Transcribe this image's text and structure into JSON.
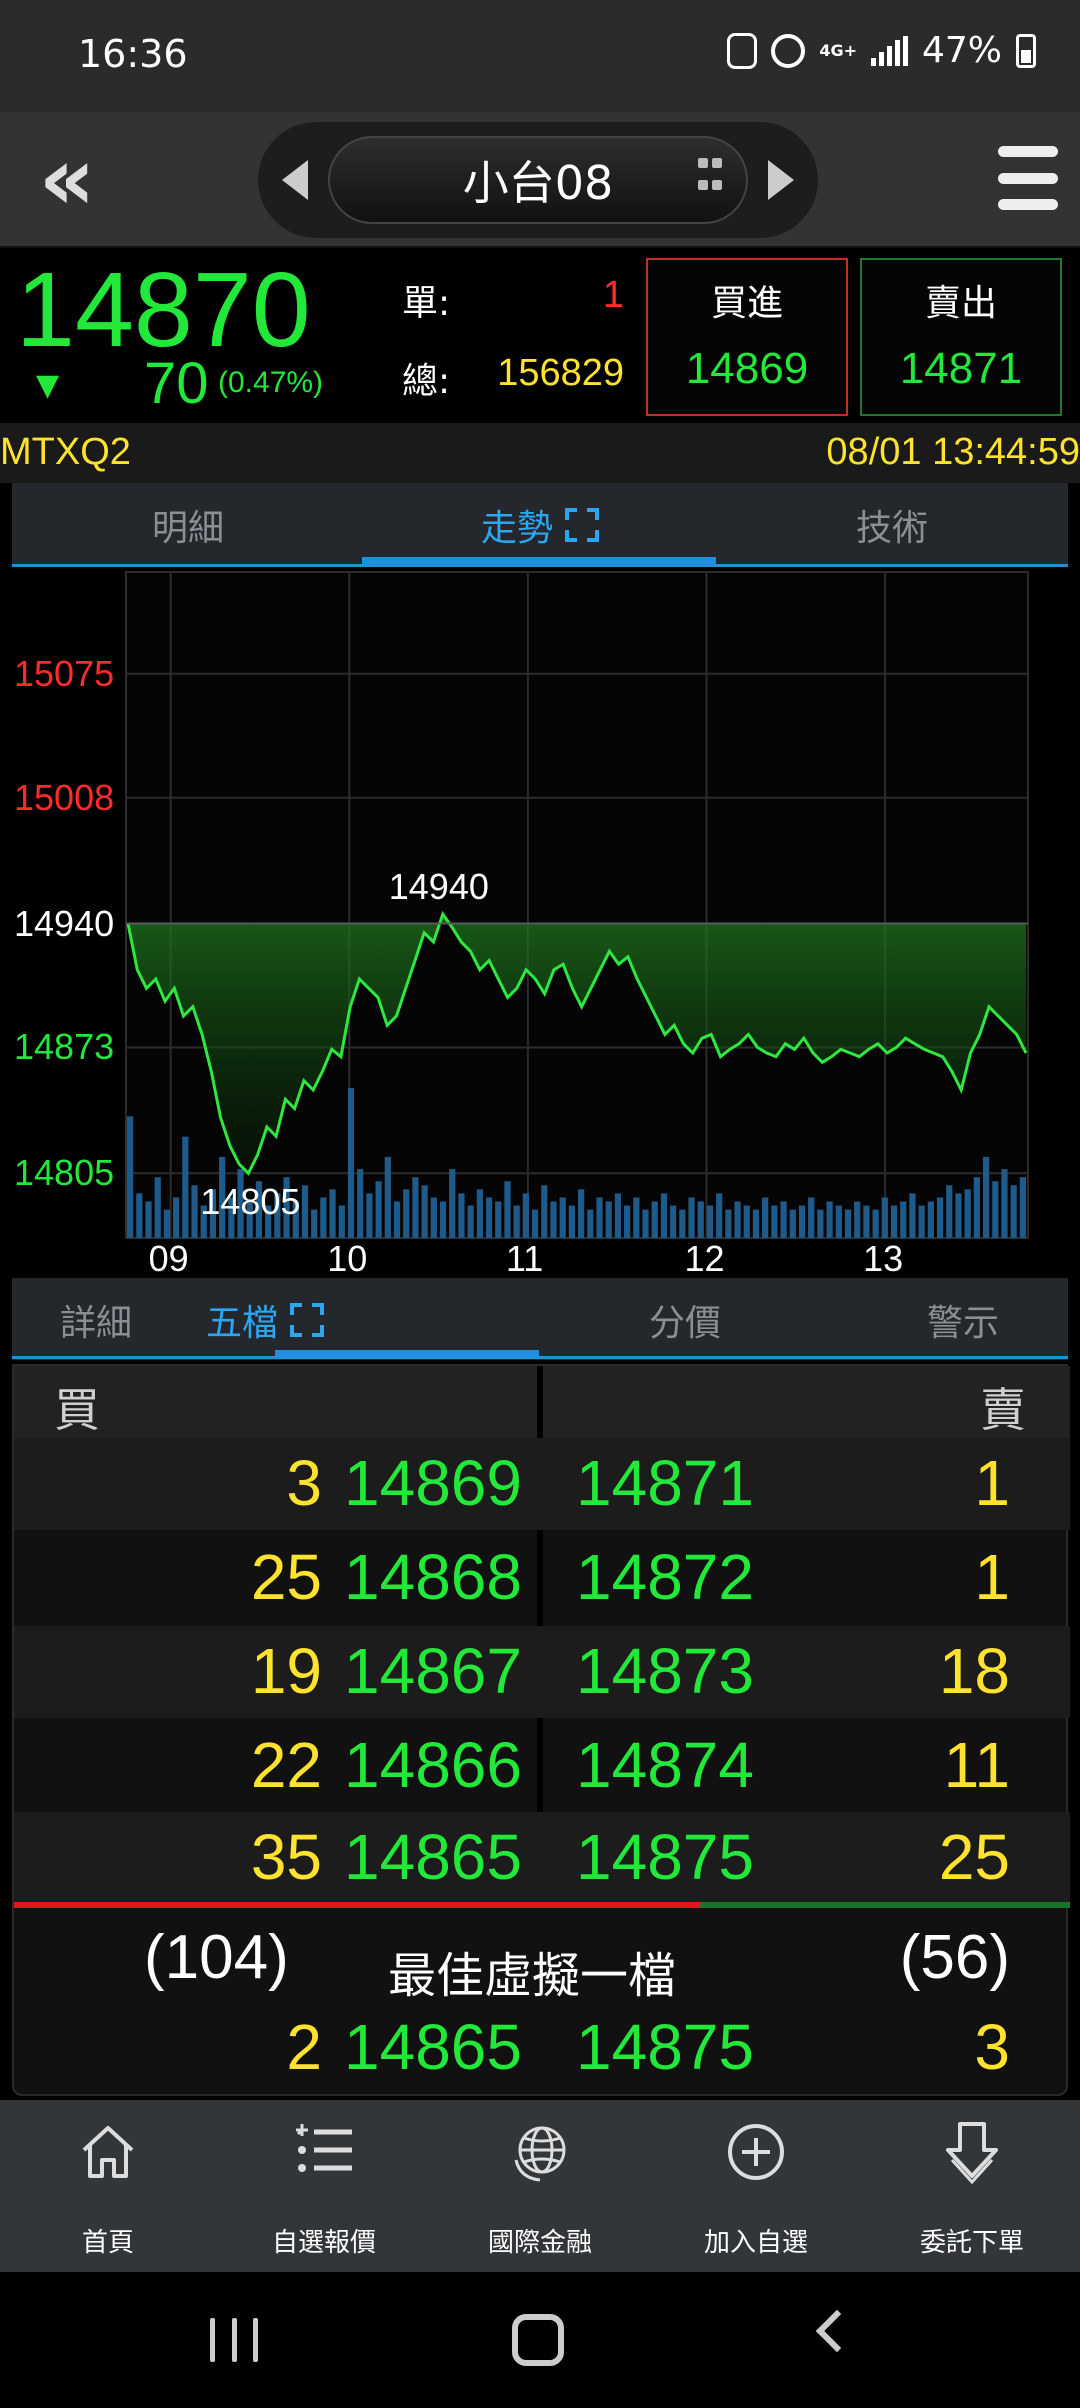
{
  "status_bar": {
    "time": "16:36",
    "network": "4G+",
    "battery": "47%"
  },
  "header": {
    "symbol": "小台08"
  },
  "quote": {
    "last": "14870",
    "change_arrow": "▼",
    "change": "70",
    "change_pct": "(0.47%)",
    "single_label": "單:",
    "single_value": "1",
    "total_label": "總:",
    "total_value": "156829",
    "bid_label": "買進",
    "bid_value": "14869",
    "ask_label": "賣出",
    "ask_value": "14871",
    "code": "MTXQ2",
    "datetime": "08/01 13:44:59"
  },
  "tabs_top": [
    {
      "label": "明細",
      "active": false
    },
    {
      "label": "走勢",
      "active": true
    },
    {
      "label": "技術",
      "active": false
    }
  ],
  "chart_data": {
    "type": "line",
    "y_ticks": [
      {
        "value": 15075,
        "label": "15075",
        "color": "#ff2a2a"
      },
      {
        "value": 15008,
        "label": "15008",
        "color": "#ff2a2a"
      },
      {
        "value": 14940,
        "label": "14940",
        "color": "#ffffff"
      },
      {
        "value": 14873,
        "label": "14873",
        "color": "#22e83a"
      },
      {
        "value": 14805,
        "label": "14805",
        "color": "#22e83a"
      }
    ],
    "x_ticks": [
      "09",
      "10",
      "11",
      "12",
      "13"
    ],
    "ylim": [
      14770,
      15130
    ],
    "reference": 14940,
    "high": {
      "value": 14940,
      "label": "14940"
    },
    "low": {
      "value": 14805,
      "label": "14805"
    },
    "series": [
      {
        "values": [
          14940,
          14915,
          14905,
          14910,
          14898,
          14905,
          14890,
          14895,
          14880,
          14860,
          14835,
          14820,
          14810,
          14805,
          14815,
          14830,
          14825,
          14845,
          14840,
          14855,
          14850,
          14860,
          14872,
          14868,
          14895,
          14910,
          14905,
          14900,
          14885,
          14890,
          14905,
          14920,
          14935,
          14930,
          14945,
          14938,
          14930,
          14925,
          14915,
          14920,
          14910,
          14900,
          14905,
          14915,
          14910,
          14902,
          14915,
          14918,
          14905,
          14895,
          14905,
          14915,
          14925,
          14918,
          14922,
          14910,
          14900,
          14890,
          14880,
          14885,
          14875,
          14870,
          14878,
          14880,
          14868,
          14872,
          14875,
          14880,
          14873,
          14870,
          14868,
          14875,
          14872,
          14878,
          14870,
          14865,
          14868,
          14872,
          14870,
          14868,
          14872,
          14875,
          14870,
          14873,
          14878,
          14875,
          14872,
          14870,
          14868,
          14860,
          14850,
          14870,
          14880,
          14895,
          14890,
          14885,
          14880,
          14870
        ]
      }
    ],
    "volume": [
      60,
      22,
      18,
      30,
      14,
      20,
      50,
      26,
      16,
      24,
      40,
      20,
      34,
      18,
      28,
      16,
      22,
      30,
      18,
      26,
      14,
      20,
      24,
      16,
      74,
      34,
      22,
      28,
      40,
      18,
      24,
      30,
      26,
      20,
      18,
      34,
      22,
      16,
      24,
      20,
      18,
      28,
      16,
      22,
      14,
      26,
      18,
      20,
      16,
      24,
      14,
      20,
      18,
      22,
      16,
      20,
      14,
      18,
      22,
      16,
      14,
      20,
      18,
      16,
      22,
      14,
      18,
      16,
      14,
      20,
      16,
      18,
      14,
      16,
      20,
      14,
      18,
      16,
      14,
      18,
      16,
      14,
      20,
      16,
      18,
      22,
      16,
      18,
      20,
      26,
      22,
      24,
      30,
      40,
      28,
      34,
      26,
      30
    ]
  },
  "tabs_bottom": [
    {
      "label": "詳細",
      "active": false
    },
    {
      "label": "五檔",
      "active": true
    },
    {
      "label": "分價",
      "active": false
    },
    {
      "label": "警示",
      "active": false
    }
  ],
  "order_book": {
    "buy_label": "買",
    "sell_label": "賣",
    "rows": [
      {
        "bid_qty": "3",
        "bid": "14869",
        "ask": "14871",
        "ask_qty": "1"
      },
      {
        "bid_qty": "25",
        "bid": "14868",
        "ask": "14872",
        "ask_qty": "1"
      },
      {
        "bid_qty": "19",
        "bid": "14867",
        "ask": "14873",
        "ask_qty": "18"
      },
      {
        "bid_qty": "22",
        "bid": "14866",
        "ask": "14874",
        "ask_qty": "11"
      },
      {
        "bid_qty": "35",
        "bid": "14865",
        "ask": "14875",
        "ask_qty": "25"
      }
    ],
    "total_bid": "(104)",
    "total_ask": "(56)",
    "buy_ratio": 0.65,
    "best_label": "最佳虛擬一檔",
    "best": {
      "bid_qty": "2",
      "bid": "14865",
      "ask": "14875",
      "ask_qty": "3"
    }
  },
  "bottom_nav": [
    {
      "label": "首頁",
      "icon": "home-icon"
    },
    {
      "label": "自選報價",
      "icon": "list-icon"
    },
    {
      "label": "國際金融",
      "icon": "globe-icon"
    },
    {
      "label": "加入自選",
      "icon": "add-circle-icon"
    },
    {
      "label": "委託下單",
      "icon": "order-icon"
    }
  ],
  "colors": {
    "up": "#ff2a2a",
    "down": "#22e83a",
    "qty": "#ffe22e",
    "accent": "#2ca6f0"
  }
}
